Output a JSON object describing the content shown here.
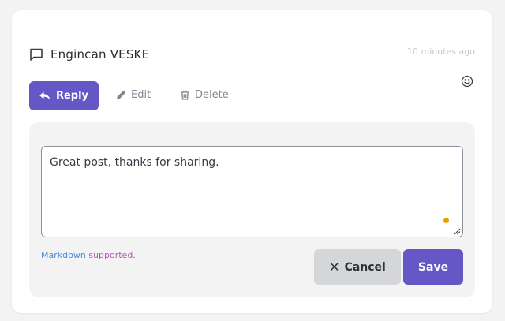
{
  "comment": {
    "author": "Engincan VESKE",
    "timestamp": "10 minutes ago",
    "icons": {
      "comment": "comment-icon",
      "emoji": "smiley-icon"
    }
  },
  "actions": {
    "reply_label": "Reply",
    "edit_label": "Edit",
    "delete_label": "Delete",
    "icons": {
      "reply": "reply-arrow-icon",
      "edit": "pencil-icon",
      "delete": "trash-icon"
    }
  },
  "editor": {
    "value": "Great post, thanks for sharing.",
    "markdown_link": "Markdown",
    "markdown_suffix": "supported.",
    "cancel_glyph": "✕",
    "cancel_label": "Cancel",
    "save_label": "Save"
  },
  "colors": {
    "primary": "#6657c7",
    "secondary": "#d5d6da",
    "panel": "#f3f3f4",
    "indicator": "#e7a000",
    "link": "#4a8fd6",
    "link_alt": "#b25bb8"
  }
}
